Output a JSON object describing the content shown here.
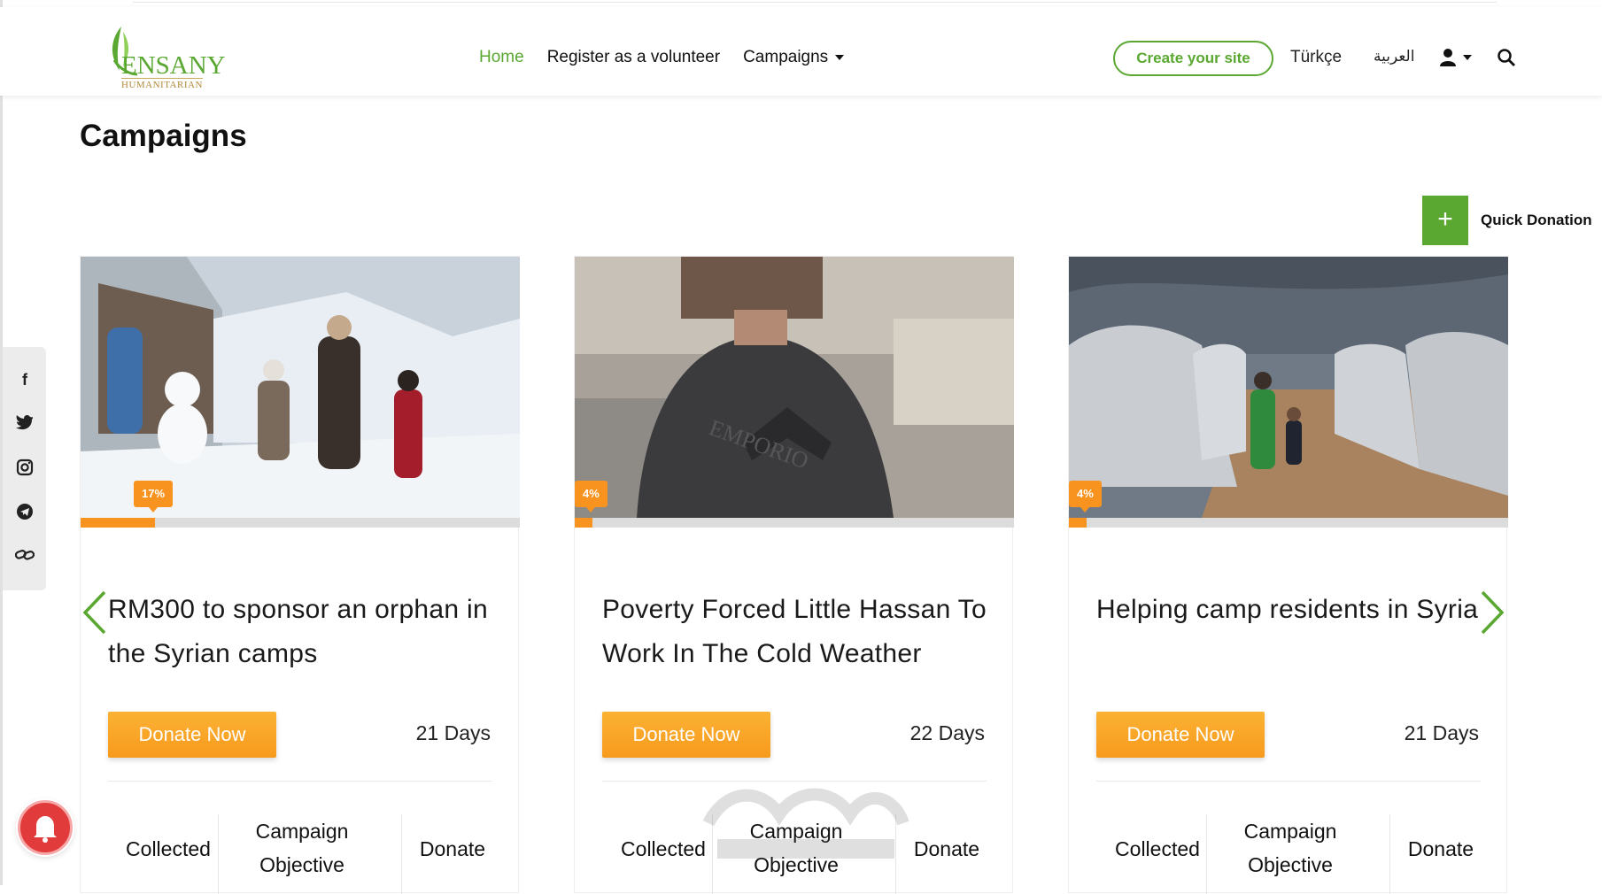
{
  "nav": {
    "logo_brand": "ENSANY",
    "logo_sub": "HUMANITARIAN",
    "home": "Home",
    "volunteer": "Register as a volunteer",
    "campaigns": "Campaigns",
    "create_site": "Create your site",
    "lang_tr": "Türkçe",
    "lang_ar": "العربية",
    "icons": [
      "user-icon",
      "search-icon"
    ]
  },
  "page_title": "Campaigns",
  "quick_donation": {
    "icon": "+",
    "label": "Quick Donation"
  },
  "social": [
    "facebook-icon",
    "twitter-icon",
    "instagram-icon",
    "telegram-icon",
    "link-icon"
  ],
  "cards": [
    {
      "percent_label": "17%",
      "progress": 0.17,
      "title": "RM300 to sponsor an orphan in the Syrian camps",
      "donate": "Donate Now",
      "days": "21 Days",
      "collected": "Collected",
      "objective": "Campaign Objective",
      "donate_stat": "Donate"
    },
    {
      "percent_label": "4%",
      "progress": 0.04,
      "title": "Poverty Forced Little Hassan To Work In The Cold Weather",
      "donate": "Donate Now",
      "days": "22 Days",
      "collected": "Collected",
      "objective": "Campaign Objective",
      "donate_stat": "Donate"
    },
    {
      "percent_label": "4%",
      "progress": 0.04,
      "title": "Helping camp residents in Syria",
      "donate": "Donate Now",
      "days": "21 Days",
      "collected": "Collected",
      "objective": "Campaign Objective",
      "donate_stat": "Donate"
    }
  ],
  "colors": {
    "brand_green": "#5aa832",
    "accent_orange": "#f7931e",
    "notification_red": "#e23b3b"
  }
}
